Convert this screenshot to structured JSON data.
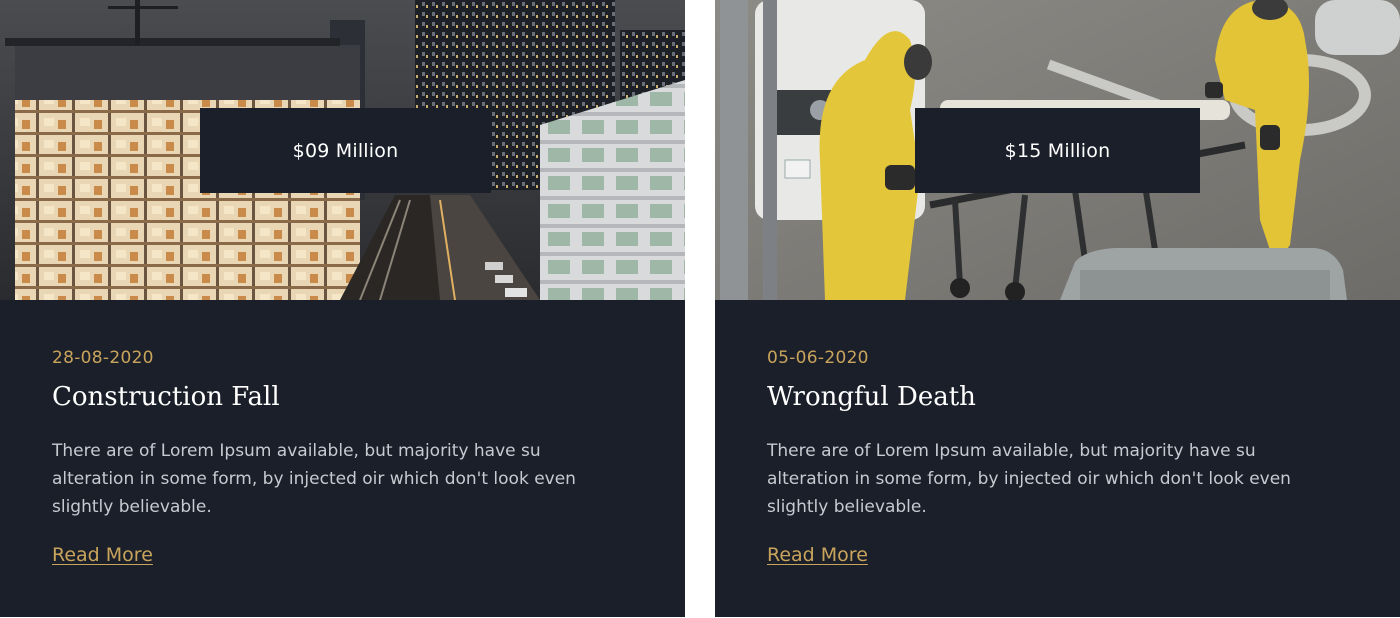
{
  "cards": [
    {
      "amount": "$09 Million",
      "date": "28-08-2020",
      "title": "Construction Fall",
      "text_lines": [
        "There are  of Lorem Ipsum available, but majority have su",
        "alteration in some form, by injected oir  which don't look even",
        "slightly believable."
      ],
      "read_more": "Read More"
    },
    {
      "amount": "$15 Million",
      "date": "05-06-2020",
      "title": "Wrongful Death",
      "text_lines": [
        "There are  of Lorem Ipsum available, but majority have su",
        "alteration in some form, by injected oir  which don't look even",
        "slightly believable."
      ],
      "read_more": "Read More"
    }
  ],
  "colors": {
    "card_bg": "#1b1f29",
    "accent": "#c9a45c",
    "body_text": "#c7cad1",
    "title": "#ffffff"
  }
}
